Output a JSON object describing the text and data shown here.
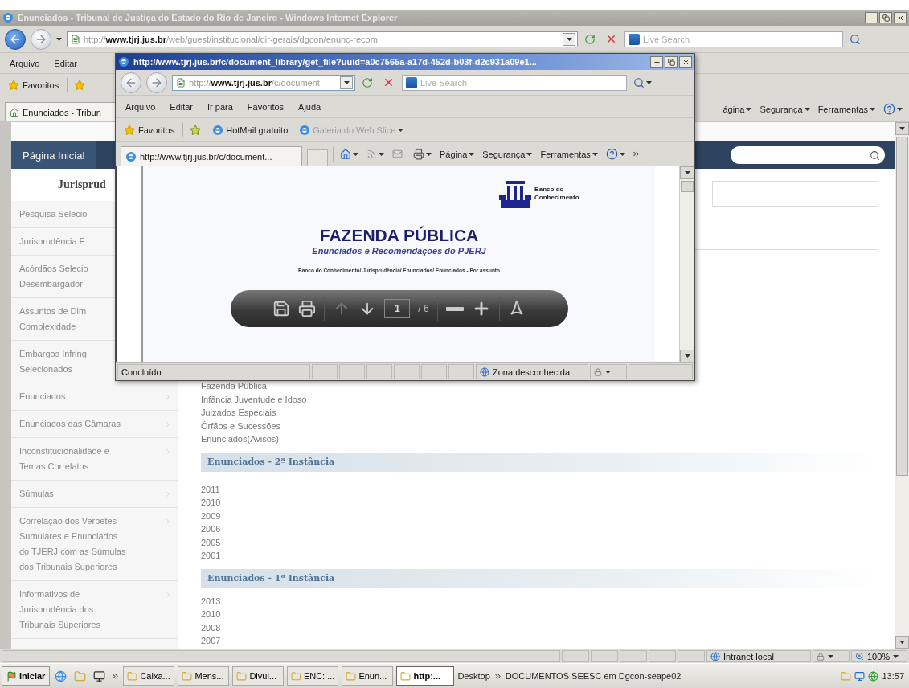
{
  "main_window": {
    "title": "Enunciados - Tribunal de Justiça do Estado do Rio de Janeiro - Windows Internet Explorer",
    "address": "http://**www.tjrj.jus.br**/web/guest/institucional/dir-gerais/dgcon/enunc-recom",
    "search_placeholder": "Live Search",
    "menu": [
      "Arquivo",
      "Editar"
    ],
    "favorites_label": "Favoritos",
    "tab": "Enunciados - Tribun",
    "commands": [
      "ágina",
      "Segurança",
      "Ferramentas"
    ],
    "page": {
      "home_link": "Página Inicial",
      "sidebar": {
        "heading": "Jurisprud",
        "items": [
          {
            "lines": [
              "Pesquisa Selecio"
            ]
          },
          {
            "lines": [
              "Jurisprudência F"
            ]
          },
          {
            "lines": [
              "Acórdãos Selecio",
              "Desembargador"
            ]
          },
          {
            "lines": [
              "Assuntos de Dim",
              "Complexidade"
            ]
          },
          {
            "lines": [
              "Embargos Infring",
              "Selecionados"
            ]
          },
          {
            "lines": [
              "Enunciados"
            ]
          },
          {
            "lines": [
              "Enunciados das Câmaras"
            ]
          },
          {
            "lines": [
              "Inconstitucionalidade e",
              "Temas Correlatos"
            ]
          },
          {
            "lines": [
              "Súmulas"
            ]
          },
          {
            "lines": [
              "Correlação dos Verbetes",
              "Sumulares e Enunciados",
              "do TJERJ com as Súmulas",
              "dos Tribunais Superiores"
            ]
          },
          {
            "lines": [
              "Informativos de",
              "Jurisprudência dos",
              "Tribunais Superiores"
            ]
          }
        ]
      },
      "topics": [
        "Fazenda Pública",
        "Infância Juventude e Idoso",
        "Juizados Especiais",
        "Órfãos e Sucessões",
        "Enunciados(Avisos)"
      ],
      "sections": [
        {
          "title": "Enunciados - 2ª Instância",
          "years": [
            "2011",
            "2010",
            "2009",
            "2006",
            "2005",
            "2001"
          ]
        },
        {
          "title": "Enunciados - 1ª Instância",
          "years": [
            "2013",
            "2010",
            "2008",
            "2007"
          ]
        }
      ]
    },
    "status_bar": {
      "zone": "Intranet local",
      "zoom": "100%"
    }
  },
  "popup_window": {
    "title": "http://www.tjrj.jus.br/c/document_library/get_file?uuid=a0c7565a-a17d-452d-b03f-d2c931a09e1...",
    "address": "http://**www.tjrj.jus.br**/c/document",
    "search_placeholder": "Live Search",
    "menu": [
      "Arquivo",
      "Editar",
      "Ir para",
      "Favoritos",
      "Ajuda"
    ],
    "favorites": {
      "label": "Favoritos",
      "links": [
        {
          "label": "HotMail gratuito",
          "disabled": false
        },
        {
          "label": "Galeria do Web Slice",
          "disabled": true
        }
      ]
    },
    "tab": "http://www.tjrj.jus.br/c/document...",
    "commands": [
      "Página",
      "Segurança",
      "Ferramentas"
    ],
    "document": {
      "logo_text": "Banco do Conhecimento",
      "title": "FAZENDA PÚBLICA",
      "subtitle": "Enunciados e Recomendações do PJERJ",
      "breadcrumb": "Banco do Conhecimento/ Jurisprudência/ Enunciados/ Enunciados - Por assunto",
      "pdf_toolbar": {
        "page": "1",
        "total": "/ 6"
      }
    },
    "status_bar": {
      "text": "Concluído",
      "zone": "Zona desconhecida"
    }
  },
  "taskbar": {
    "start": "Iniciar",
    "buttons": [
      {
        "label": "Caixa...",
        "selected": false
      },
      {
        "label": "Mens...",
        "selected": false
      },
      {
        "label": "Divul...",
        "selected": false
      },
      {
        "label": "ENC: ...",
        "selected": false
      },
      {
        "label": "Enun...",
        "selected": false
      },
      {
        "label": "http:...",
        "selected": true
      }
    ],
    "desktop": "Desktop",
    "folder": "DOCUMENTOS SEESC em Dgcon-seape02",
    "clock": "13:57"
  }
}
